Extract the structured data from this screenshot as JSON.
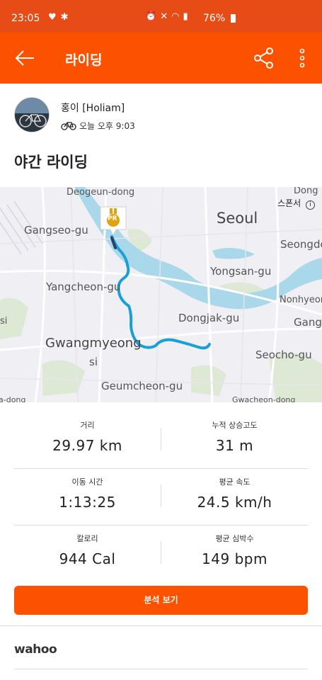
{
  "status_bar": {
    "time": "23:05",
    "battery": "76%",
    "icons": [
      "heart-icon",
      "bluetooth-icon",
      "alarm-icon",
      "mute-icon",
      "wifi-icon",
      "signal-icon",
      "battery-icon"
    ]
  },
  "app_bar": {
    "title": "라이딩",
    "back_icon": "arrow-left-icon",
    "share_icon": "share-icon",
    "more_icon": "more-vertical-icon"
  },
  "athlete": {
    "name": "홍이 [Holiam]",
    "time": "오늘 오후 9:03",
    "activity_icon": "bike-icon"
  },
  "activity": {
    "title": "야간 라이딩"
  },
  "map": {
    "sponsor_label": "스폰서",
    "badge": "PR",
    "labels": {
      "deogeun": "Deogeun-dong",
      "dong": "Dong",
      "gangseo": "Gangseo-gu",
      "seoul": "Seoul",
      "seongdo": "Seongdo",
      "yongsan": "Yongsan-gu",
      "yangcheon": "Yangcheon-gu",
      "nonhyeon": "Nonhyeon-d",
      "si_left": "si",
      "dongjak": "Dongjak-gu",
      "gang": "Gang",
      "gwangmyeong": "Gwangmyeong",
      "si": "si",
      "seocho": "Seocho-gu",
      "geumcheon": "Geumcheon-gu",
      "bottom_left": "a-dong",
      "gwacheon": "Gwacheon-dong"
    },
    "route_color": "#1a9fd6",
    "water_color": "#a9d8ea"
  },
  "stats": [
    {
      "label": "거리",
      "value": "29.97 km"
    },
    {
      "label": "누적 상승고도",
      "value": "31 m"
    },
    {
      "label": "이동 시간",
      "value": "1:13:25"
    },
    {
      "label": "평균 속도",
      "value": "24.5 km/h"
    },
    {
      "label": "칼로리",
      "value": "944 Cal"
    },
    {
      "label": "평균 심박수",
      "value": "149 bpm"
    }
  ],
  "analyze_button": "분석 보기",
  "device": "wahoo",
  "colors": {
    "accent": "#fc5200",
    "status_bar": "#e84c16"
  }
}
